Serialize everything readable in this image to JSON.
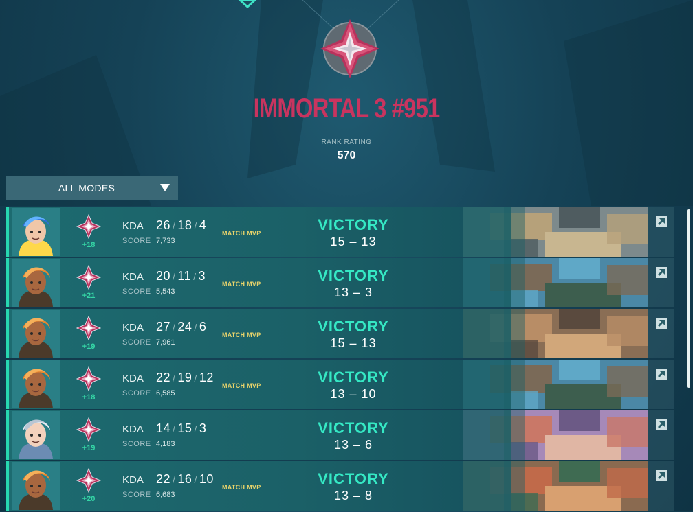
{
  "rank": {
    "title": "IMMORTAL 3 #951",
    "rr_label": "RANK RATING",
    "rr_value": "570",
    "color": "#c9345f"
  },
  "filter": {
    "selected": "ALL MODES"
  },
  "labels": {
    "kda": "KDA",
    "score": "SCORE",
    "mvp": "MATCH MVP"
  },
  "matches": [
    {
      "agent": "neon",
      "rr_change": "+18",
      "kills": "26",
      "deaths": "18",
      "assists": "4",
      "score": "7,733",
      "mvp": true,
      "result": "VICTORY",
      "score_us": "15",
      "score_them": "13",
      "map": "map-a"
    },
    {
      "agent": "raze",
      "rr_change": "+21",
      "kills": "20",
      "deaths": "11",
      "assists": "3",
      "score": "5,543",
      "mvp": true,
      "result": "VICTORY",
      "score_us": "13",
      "score_them": "3",
      "map": "map-b"
    },
    {
      "agent": "raze",
      "rr_change": "+19",
      "kills": "27",
      "deaths": "24",
      "assists": "6",
      "score": "7,961",
      "mvp": true,
      "result": "VICTORY",
      "score_us": "15",
      "score_them": "13",
      "map": "map-c"
    },
    {
      "agent": "raze",
      "rr_change": "+18",
      "kills": "22",
      "deaths": "19",
      "assists": "12",
      "score": "6,585",
      "mvp": true,
      "result": "VICTORY",
      "score_us": "13",
      "score_them": "10",
      "map": "map-b"
    },
    {
      "agent": "jett",
      "rr_change": "+19",
      "kills": "14",
      "deaths": "15",
      "assists": "3",
      "score": "4,183",
      "mvp": false,
      "result": "VICTORY",
      "score_us": "13",
      "score_them": "6",
      "map": "map-d"
    },
    {
      "agent": "raze",
      "rr_change": "+20",
      "kills": "22",
      "deaths": "16",
      "assists": "10",
      "score": "6,683",
      "mvp": true,
      "result": "VICTORY",
      "score_us": "13",
      "score_them": "8",
      "map": "map-e"
    }
  ],
  "icons": {
    "rank": "immortal-rank-icon",
    "dropdown": "caret-down-icon",
    "details": "open-details-icon"
  },
  "colors": {
    "victory": "#35e8c4",
    "rr_gain": "#35d6a6",
    "mvp": "#e8d36b",
    "accent_bar": "#27d7b0"
  }
}
